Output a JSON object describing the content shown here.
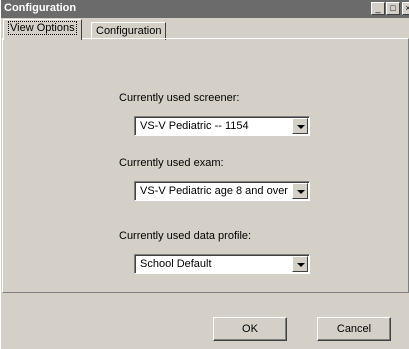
{
  "window": {
    "title": "Configuration",
    "controls": {
      "minimize": "_",
      "maximize": "□",
      "close": "×"
    }
  },
  "tabs": [
    {
      "label": "View Options",
      "active": true
    },
    {
      "label": "Configuration",
      "active": false
    }
  ],
  "fields": {
    "screener": {
      "label": "Currently used screener:",
      "value": "VS-V Pediatric  --  1154"
    },
    "exam": {
      "label": "Currently used exam:",
      "value": "VS-V Pediatric age 8 and over"
    },
    "profile": {
      "label": "Currently used data profile:",
      "value": "School Default"
    }
  },
  "buttons": {
    "ok": "OK",
    "cancel": "Cancel"
  }
}
